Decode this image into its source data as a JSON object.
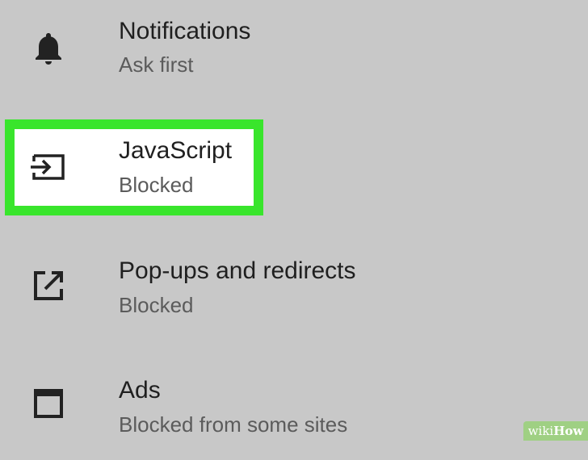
{
  "settings": {
    "items": [
      {
        "title": "Notifications",
        "subtitle": "Ask first",
        "icon": "bell-icon"
      },
      {
        "title": "JavaScript",
        "subtitle": "Blocked",
        "icon": "javascript-enter-icon"
      },
      {
        "title": "Pop-ups and redirects",
        "subtitle": "Blocked",
        "icon": "popup-open-external-icon"
      },
      {
        "title": "Ads",
        "subtitle": "Blocked from some sites",
        "icon": "ads-window-icon"
      }
    ]
  },
  "highlight": {
    "color": "#39e52c",
    "target_item": "JavaScript"
  },
  "watermark": {
    "part1": "wiki",
    "part2": "How"
  },
  "colors": {
    "background": "#c8c8c8",
    "title_text": "#1f1f1f",
    "subtitle_text": "#5b5b5b",
    "icon": "#222222"
  }
}
